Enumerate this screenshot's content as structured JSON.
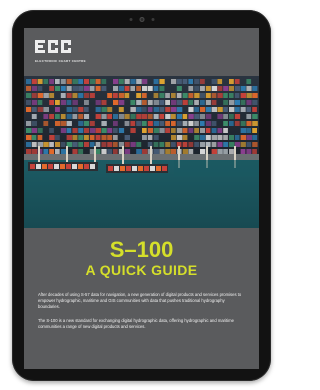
{
  "brand": {
    "logo_text": "ECC",
    "caption": "ELECTRONIC CHART CENTRE"
  },
  "cover": {
    "title": "S–100",
    "subtitle": "A QUICK GUIDE",
    "paragraph_1": "After decades of using S-57 data for navigation, a new generation of digital products and services promises to empower hydrographic, maritime and GIS communities with data that pushes traditional hydrography boundaries.",
    "paragraph_2": "The S-100 is a new standard for exchanging digital hydrographic data, offering hydrographic and maritime communities a range of new digital products and services."
  },
  "colors": {
    "accent": "#d5df2a",
    "bezel": "#121212",
    "cover_background": "#5a5b5d",
    "sea": "#1f5f68"
  },
  "icons": {
    "camera": "camera-icon"
  }
}
